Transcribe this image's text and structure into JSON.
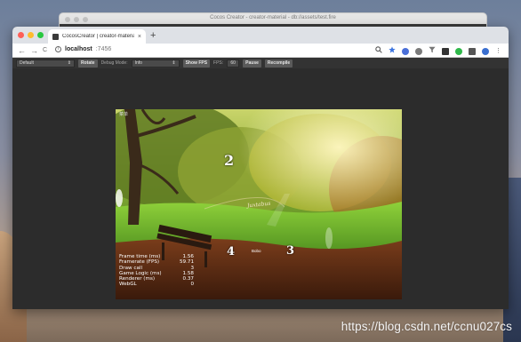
{
  "background_window": {
    "title": "Cocos Creator - creator-material - db://assets/test.fire"
  },
  "browser": {
    "tab_title": "CocosCreator | creator-material",
    "tab_close": "×",
    "new_tab": "+",
    "url_host": "localhost",
    "url_port": ":7456",
    "nav": {
      "back": "←",
      "forward": "→",
      "reload": "C"
    }
  },
  "preview_toolbar": {
    "device_select": "Default",
    "rotate_label": "Rotate",
    "debug_mode_label": "Debug Mode:",
    "debug_mode_value": "Info",
    "show_fps_label": "Show FPS",
    "fps_label": "FPS:",
    "fps_value": "60",
    "pause_label": "Pause",
    "recompile_label": "Recompile"
  },
  "canvas": {
    "corner_text": "菜单",
    "numbers": {
      "n2": "2",
      "n3": "3",
      "n4": "4"
    },
    "banner_text": "Juxtabus",
    "small_label": "Bobo"
  },
  "stats": [
    {
      "label": "Frame time (ms)",
      "value": "1.56"
    },
    {
      "label": "Framerate (FPS)",
      "value": "59.71"
    },
    {
      "label": "Draw call",
      "value": "3"
    },
    {
      "label": "Game Logic (ms)",
      "value": "1.58"
    },
    {
      "label": "Renderer (ms)",
      "value": "0.37"
    },
    {
      "label": "WebGL",
      "value": "0"
    }
  ],
  "watermark": "https://blog.csdn.net/ccnu027cs",
  "colors": {
    "traffic_red": "#fe5f57",
    "traffic_yellow": "#febc2e",
    "traffic_green": "#28c840",
    "toolbar_bg": "#333333",
    "content_bg": "#2c2c2c"
  }
}
